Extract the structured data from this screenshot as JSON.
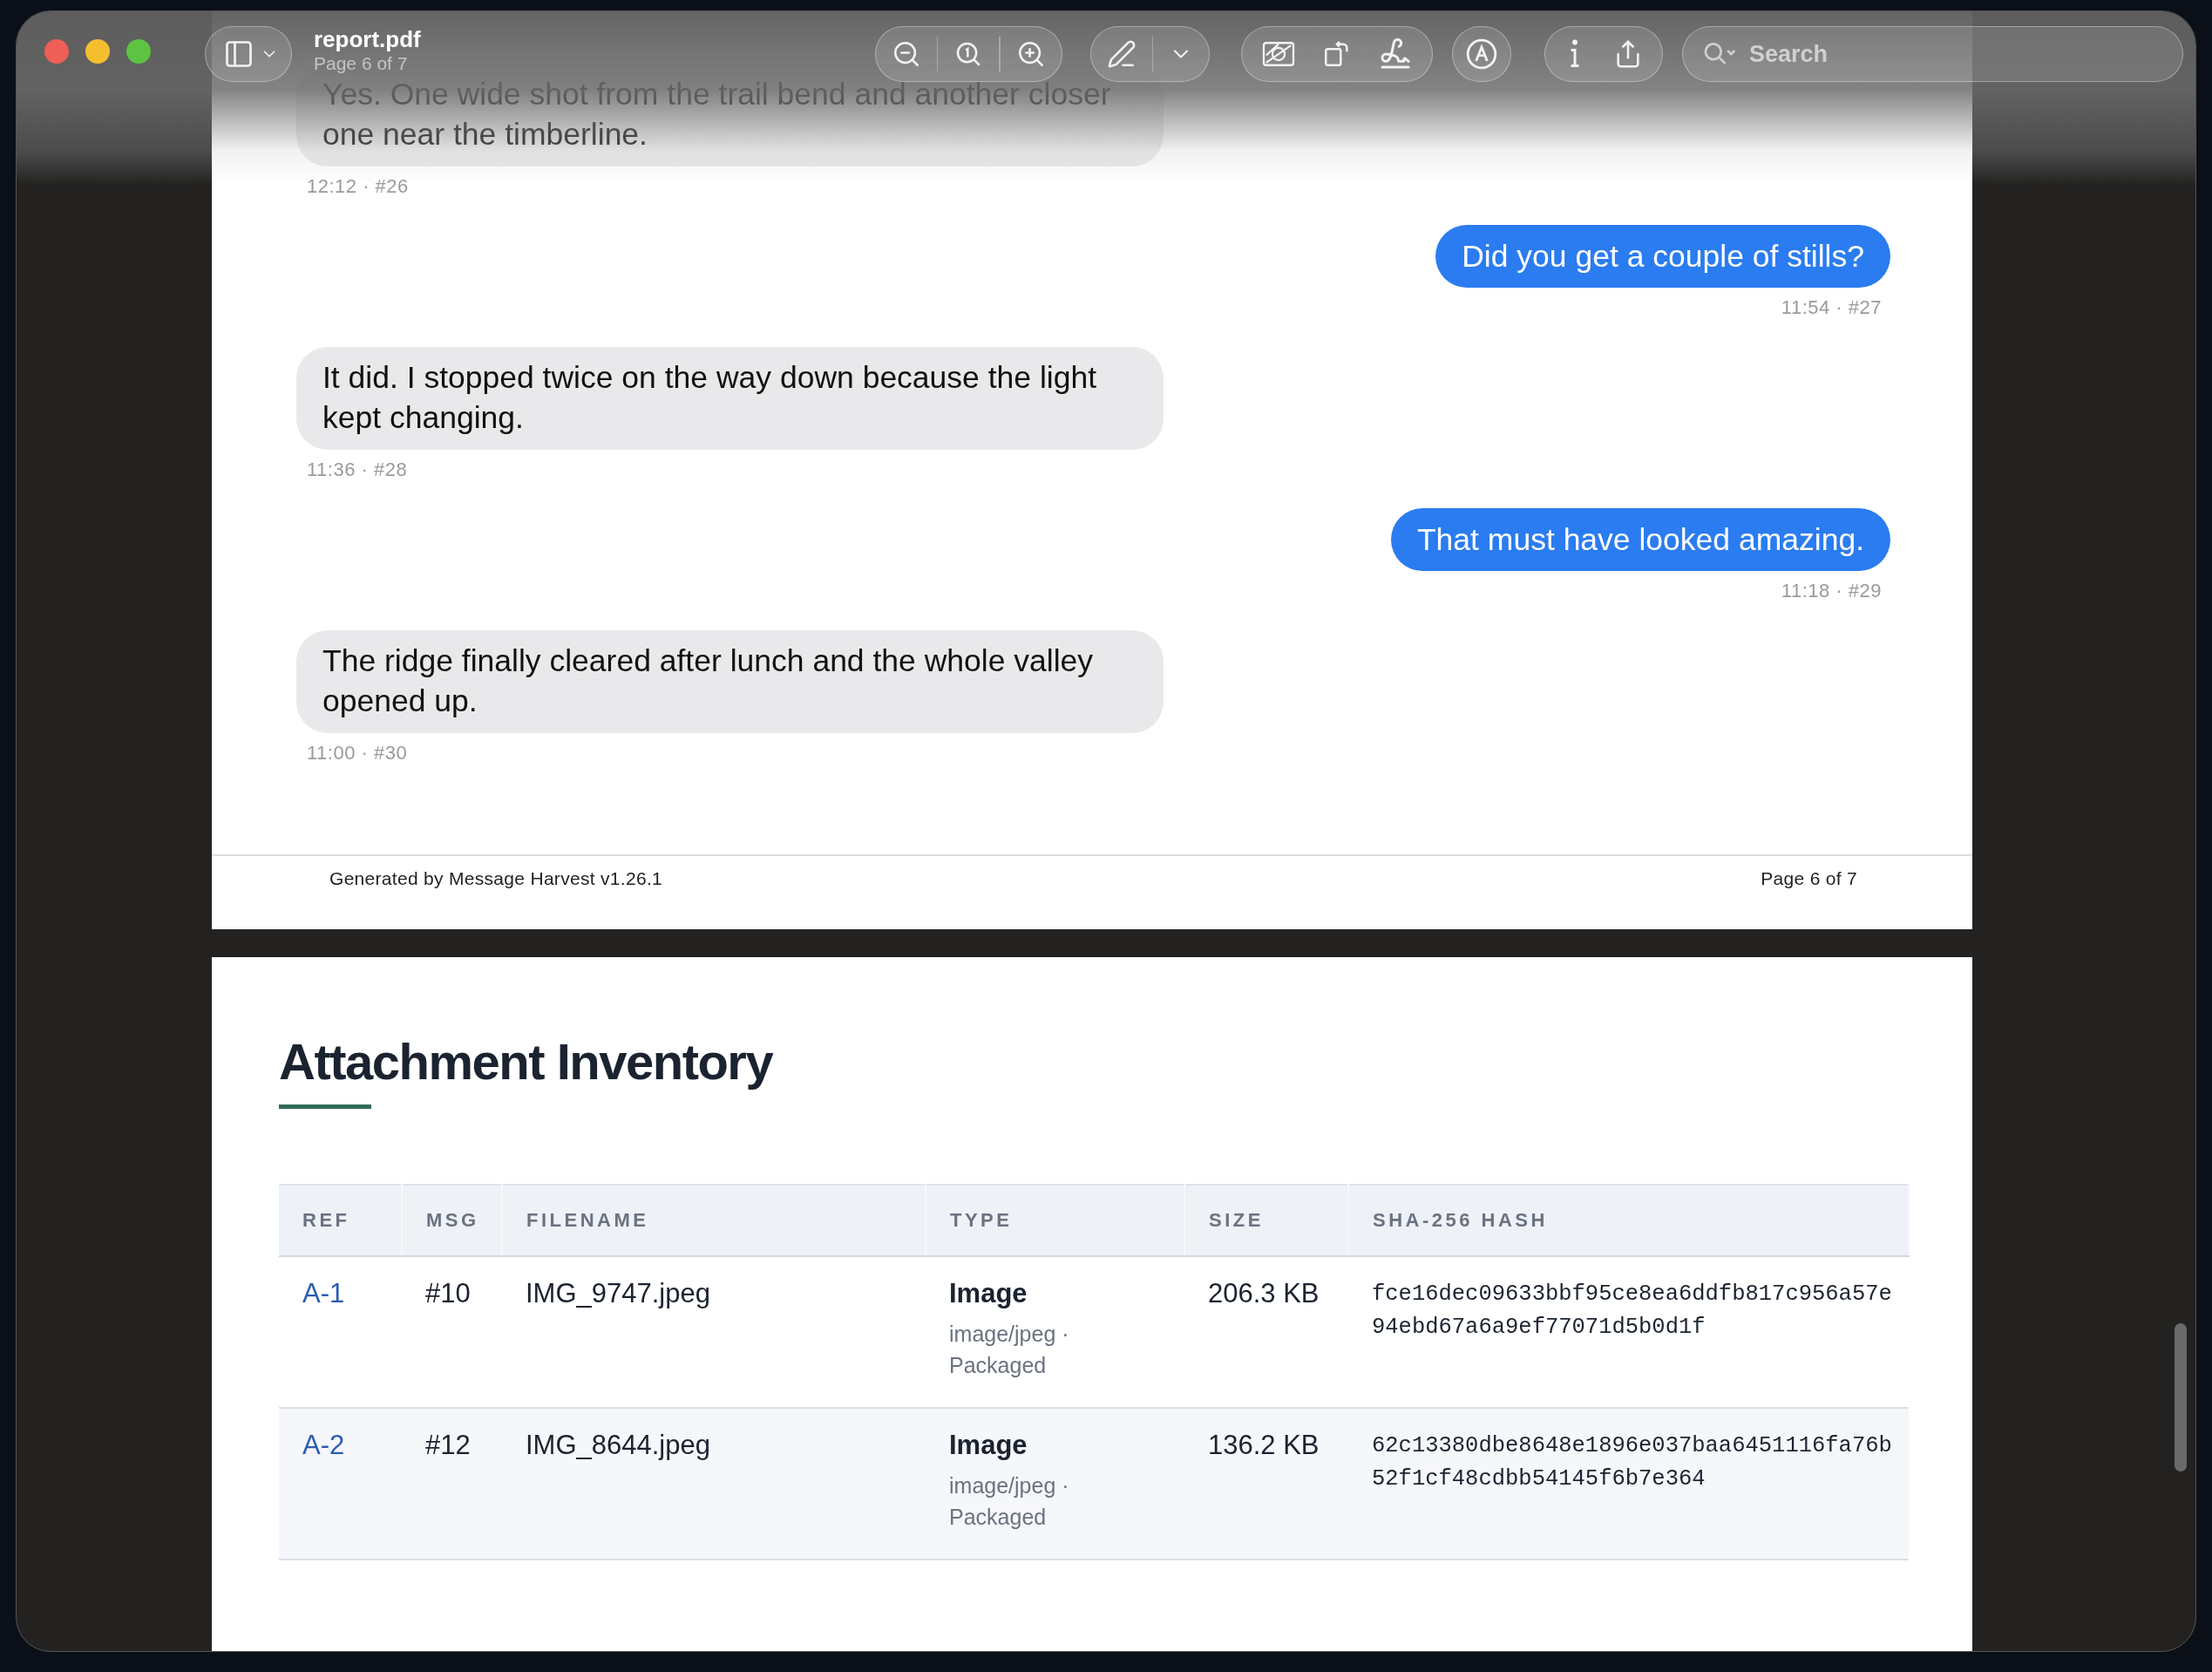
{
  "window": {
    "title": "report.pdf",
    "subtitle": "Page 6 of 7"
  },
  "search": {
    "placeholder": "Search"
  },
  "messages": [
    {
      "kind": "received",
      "text": "Yes. One wide shot from the trail bend and another closer one near the timberline.",
      "meta": "12:12 · #26"
    },
    {
      "kind": "sent",
      "text": "Did you get a couple of stills?",
      "meta": "11:54 · #27"
    },
    {
      "kind": "received",
      "text": "It did. I stopped twice on the way down because the light kept changing.",
      "meta": "11:36 · #28"
    },
    {
      "kind": "sent",
      "text": "That must have looked amazing.",
      "meta": "11:18 · #29"
    },
    {
      "kind": "received",
      "text": "The ridge finally cleared after lunch and the whole valley opened up.",
      "meta": "11:00 · #30"
    }
  ],
  "footer": {
    "left": "Generated by Message Harvest v1.26.1",
    "right": "Page 6 of 7"
  },
  "section": {
    "title": "Attachment Inventory"
  },
  "table": {
    "columns": [
      "REF",
      "MSG",
      "FILENAME",
      "TYPE",
      "SIZE",
      "SHA-256 HASH"
    ],
    "rows": [
      {
        "ref": "A-1",
        "msg": "#10",
        "filename": "IMG_9747.jpeg",
        "type": "Image",
        "type_detail": "image/jpeg · Packaged",
        "size": "206.3 KB",
        "hash": "fce16dec09633bbf95ce8ea6ddfb817c956a57e94ebd67a6a9ef77071d5b0d1f"
      },
      {
        "ref": "A-2",
        "msg": "#12",
        "filename": "IMG_8644.jpeg",
        "type": "Image",
        "type_detail": "image/jpeg · Packaged",
        "size": "136.2 KB",
        "hash": "62c13380dbe8648e1896e037baa6451116fa76b52f1cf48cdbb54145f6b7e364"
      }
    ]
  }
}
